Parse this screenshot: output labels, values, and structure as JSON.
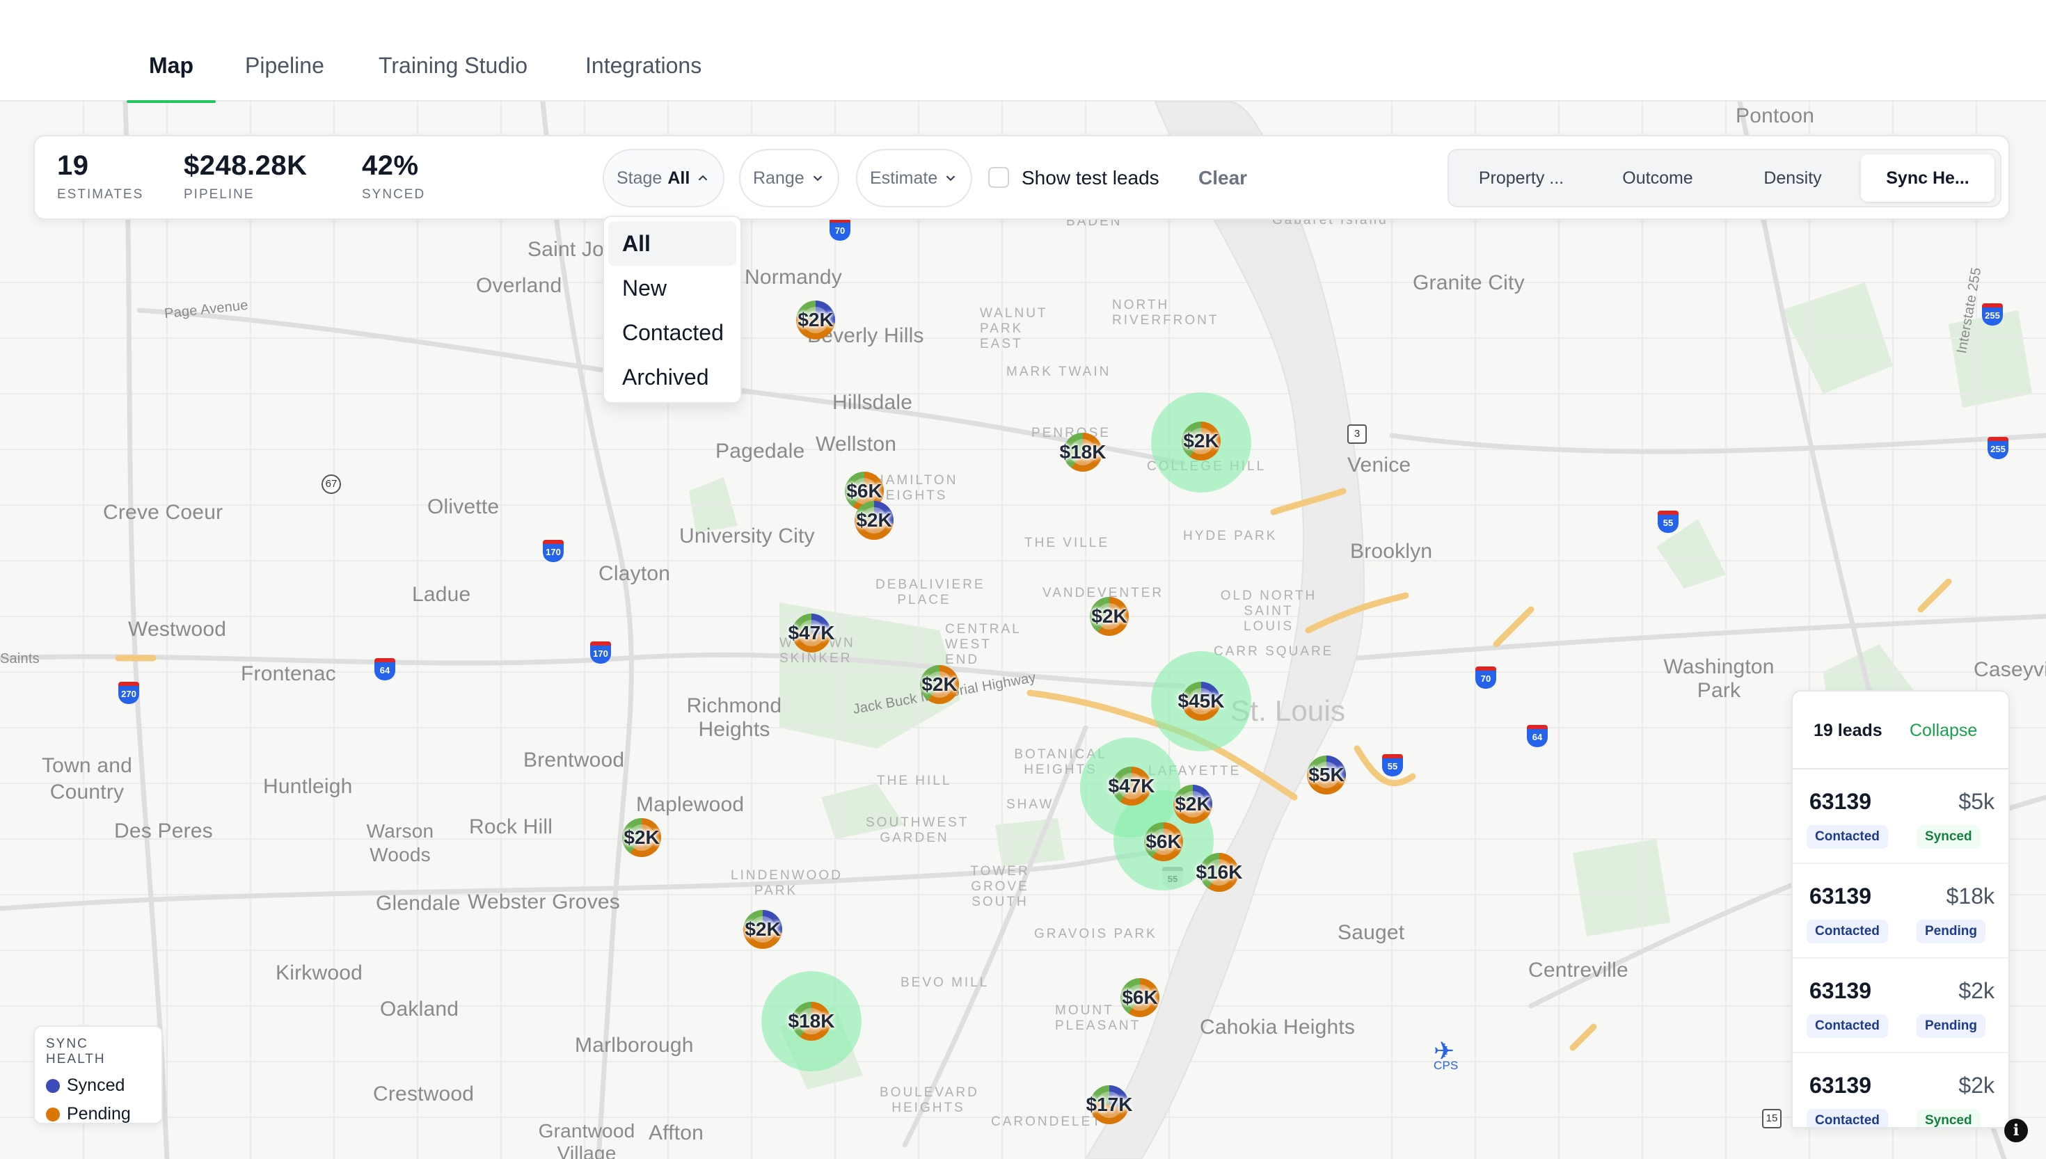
{
  "tabs": [
    {
      "label": "Map",
      "active": true
    },
    {
      "label": "Pipeline"
    },
    {
      "label": "Training Studio"
    },
    {
      "label": "Integrations"
    }
  ],
  "stats": {
    "estimates": {
      "value": "19",
      "label": "ESTIMATES"
    },
    "pipeline": {
      "value": "$248.28K",
      "label": "PIPELINE"
    },
    "synced": {
      "value": "42%",
      "label": "SYNCED"
    }
  },
  "filters": {
    "stage": {
      "label": "Stage",
      "value": "All",
      "options": [
        "All",
        "New",
        "Contacted",
        "Archived"
      ],
      "open": true
    },
    "range": {
      "label": "Range"
    },
    "estimate": {
      "label": "Estimate"
    },
    "show_test_leads": {
      "label": "Show test leads",
      "checked": false
    },
    "clear_label": "Clear"
  },
  "view_modes": [
    {
      "label": "Property ...",
      "active": false
    },
    {
      "label": "Outcome",
      "active": false
    },
    {
      "label": "Density",
      "active": false
    },
    {
      "label": "Sync He...",
      "active": true
    }
  ],
  "map": {
    "places": [
      "Saint Jo",
      "Overland",
      "Normandy",
      "Beverly Hills",
      "Hillsdale",
      "Pagedale",
      "Wellston",
      "Creve Coeur",
      "Olivette",
      "University City",
      "Clayton",
      "Ladue",
      "Westwood",
      "Frontenac",
      "Saints",
      "Richmond Heights",
      "Town and Country",
      "Huntleigh",
      "Brentwood",
      "Maplewood",
      "Des Peres",
      "Rock Hill",
      "Warson Woods",
      "Glendale",
      "Webster Groves",
      "Kirkwood",
      "Oakland",
      "Marlborough",
      "Crestwood",
      "Grantwood Village",
      "Affton",
      "Granite City",
      "Venice",
      "Brooklyn",
      "Washington Park",
      "Caseyvil",
      "Sauget",
      "Centreville",
      "Cahokia Heights",
      "Pontoon",
      "Gabaret Island",
      "St. Louis",
      "Page Avenue",
      "Jack Buck Memorial Highway",
      "Interstate 255",
      "CPS"
    ],
    "neighborhoods": [
      "WALNUT PARK EAST",
      "NORTH RIVERFRONT",
      "MARK TWAIN",
      "PENROSE",
      "COLLEGE HILL",
      "HAMILTON HEIGHTS",
      "THE VILLE",
      "HYDE PARK",
      "DEBALIVIERE PLACE",
      "VANDEVENTER",
      "OLD NORTH SAINT LOUIS",
      "WYDOWN SKINKER",
      "CENTRAL WEST END",
      "CARR SQUARE",
      "BOTANICAL HEIGHTS",
      "LAFAYETTE",
      "THE HILL",
      "SHAW",
      "SOUTHWEST GARDEN",
      "TOWER GROVE SOUTH",
      "LINDENWOOD PARK",
      "GRAVOIS PARK",
      "BEVO MILL",
      "MOUNT PLEASANT",
      "BOULEVARD HEIGHTS",
      "CARONDELET",
      "BADEN"
    ],
    "shields": [
      "70",
      "270",
      "64",
      "170",
      "170",
      "70",
      "55",
      "64",
      "55",
      "255",
      "255",
      "55"
    ],
    "routes": [
      "67",
      "3",
      "15"
    ],
    "markers": [
      {
        "label": "$2K",
        "status": "synced"
      },
      {
        "label": "$18K",
        "status": "pending"
      },
      {
        "label": "$2K",
        "status": "pending"
      },
      {
        "label": "$6K",
        "status": "pending"
      },
      {
        "label": "$2K",
        "status": "synced"
      },
      {
        "label": "$2K",
        "status": "pending"
      },
      {
        "label": "$47K",
        "status": "synced"
      },
      {
        "label": "$2K",
        "status": "pending"
      },
      {
        "label": "$45K",
        "status": "synced"
      },
      {
        "label": "$5K",
        "status": "synced"
      },
      {
        "label": "$47K",
        "status": "pending"
      },
      {
        "label": "$2K",
        "status": "synced"
      },
      {
        "label": "$6K",
        "status": "pending"
      },
      {
        "label": "$16K",
        "status": "pending"
      },
      {
        "label": "$2K",
        "status": "pending"
      },
      {
        "label": "$2K",
        "status": "synced"
      },
      {
        "label": "$18K",
        "status": "pending"
      },
      {
        "label": "$6K",
        "status": "pending"
      },
      {
        "label": "$17K",
        "status": "synced"
      }
    ]
  },
  "legend": {
    "title": "SYNC HEALTH",
    "items": [
      {
        "label": "Synced",
        "color": "#3b4cb8"
      },
      {
        "label": "Pending",
        "color": "#d97706"
      }
    ]
  },
  "leads_panel": {
    "count_label": "19 leads",
    "collapse_label": "Collapse",
    "leads": [
      {
        "zip": "63139",
        "amount": "$5k",
        "stage": "Contacted",
        "sync": "Synced"
      },
      {
        "zip": "63139",
        "amount": "$18k",
        "stage": "Contacted",
        "sync": "Pending"
      },
      {
        "zip": "63139",
        "amount": "$2k",
        "stage": "Contacted",
        "sync": "Pending"
      },
      {
        "zip": "63139",
        "amount": "$2k",
        "stage": "Contacted",
        "sync": "Synced"
      }
    ]
  },
  "colors": {
    "accent": "#22c55e",
    "synced": "#3b4cb8",
    "pending": "#d97706",
    "halo": "#86efac"
  },
  "info_icon": "i"
}
